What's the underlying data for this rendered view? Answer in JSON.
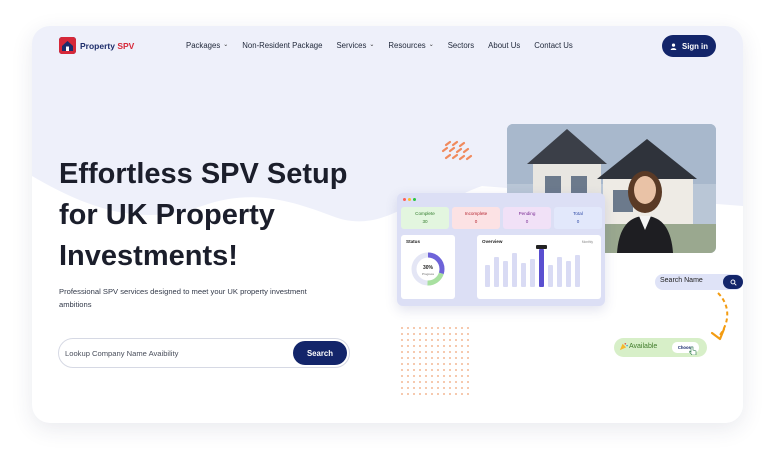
{
  "brand": {
    "name_part1": "Property",
    "name_part2": "SPV"
  },
  "nav": {
    "items": [
      {
        "label": "Packages",
        "dropdown": true
      },
      {
        "label": "Non-Resident Package",
        "dropdown": false
      },
      {
        "label": "Services",
        "dropdown": true
      },
      {
        "label": "Resources",
        "dropdown": true
      },
      {
        "label": "Sectors",
        "dropdown": false
      },
      {
        "label": "About Us",
        "dropdown": false
      },
      {
        "label": "Contact Us",
        "dropdown": false
      }
    ],
    "signin_label": "Sign in"
  },
  "hero": {
    "headline_line1": "Effortless SPV Setup",
    "headline_line2": "for UK Property",
    "headline_line3": "Investments!",
    "subtext": "Professional SPV services designed to meet your UK property investment ambitions",
    "search_placeholder": "Lookup Company Name Avaibility",
    "search_button": "Search"
  },
  "dashboard": {
    "stats": [
      {
        "label": "Complete",
        "value": "30"
      },
      {
        "label": "Incomplete",
        "value": "0"
      },
      {
        "label": "Pending",
        "value": "0"
      },
      {
        "label": "Total",
        "value": "0"
      }
    ],
    "status_title": "Status",
    "status_percent": "30%",
    "status_sub": "Progress",
    "overview_title": "Overview",
    "overview_filter": "Monthly"
  },
  "widgets": {
    "search_name_label": "Search Name",
    "available_label": "Available",
    "choose_label": "Choose"
  },
  "colors": {
    "primary": "#13256a",
    "accent_red": "#d62839",
    "accent_orange": "#f39c12",
    "hero_bg": "#eef0fa",
    "available_green": "#d7efc8"
  }
}
